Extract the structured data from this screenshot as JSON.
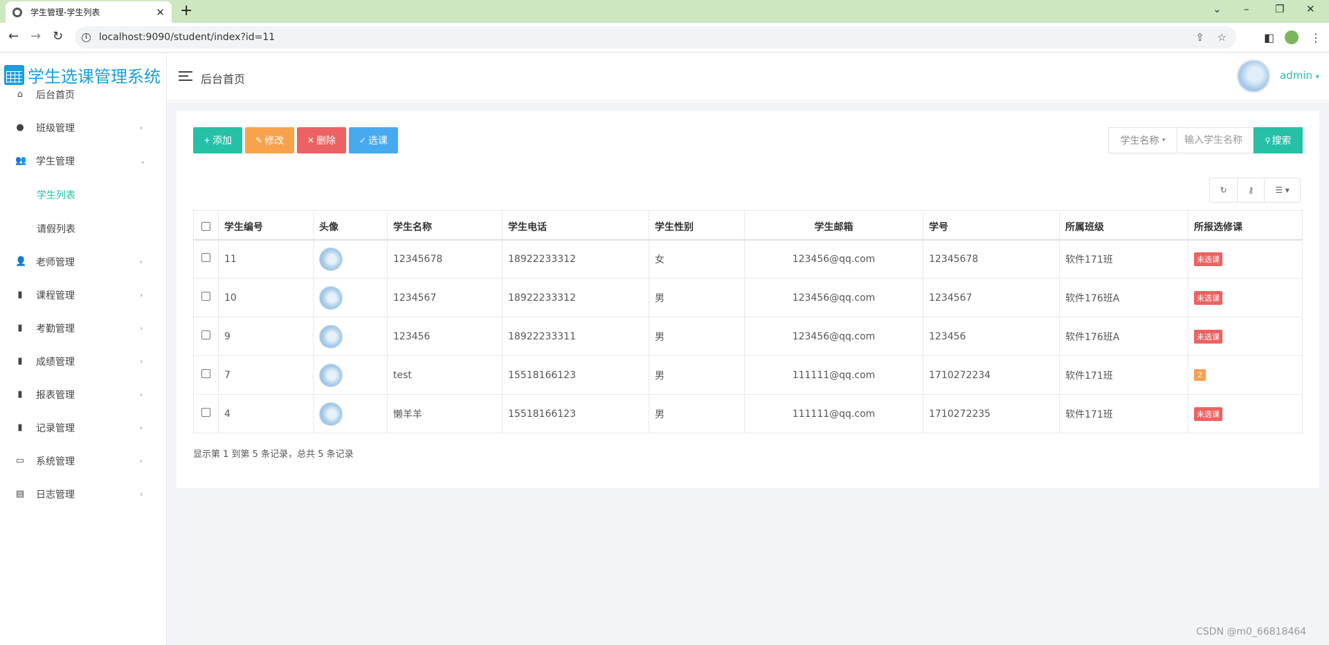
{
  "browser": {
    "tab_title": "学生管理-学生列表",
    "url": "localhost:9090/student/index?id=11"
  },
  "brand": {
    "title": "学生选课管理系统"
  },
  "sidebar": {
    "items": [
      {
        "label": "后台首页",
        "icon": "home-icon"
      },
      {
        "label": "班级管理",
        "icon": "palette-icon"
      },
      {
        "label": "学生管理",
        "icon": "users-icon"
      },
      {
        "label": "老师管理",
        "icon": "user-gear-icon"
      },
      {
        "label": "课程管理",
        "icon": "file-icon"
      },
      {
        "label": "考勤管理",
        "icon": "file-icon"
      },
      {
        "label": "成绩管理",
        "icon": "file-check-icon"
      },
      {
        "label": "报表管理",
        "icon": "file-chart-icon"
      },
      {
        "label": "记录管理",
        "icon": "file-icon"
      },
      {
        "label": "系统管理",
        "icon": "id-card-icon"
      },
      {
        "label": "日志管理",
        "icon": "list-icon"
      }
    ],
    "student_sub": [
      "学生列表",
      "请假列表"
    ]
  },
  "header": {
    "title": "后台首页",
    "user": "admin"
  },
  "toolbar": {
    "add": "添加",
    "edit": "修改",
    "delete": "删除",
    "select_course": "选课",
    "search_field": "学生名称",
    "search_placeholder": "输入学生名称",
    "search_button": "搜索"
  },
  "table": {
    "columns": [
      "学生编号",
      "头像",
      "学生名称",
      "学生电话",
      "学生性别",
      "学生邮箱",
      "学号",
      "所属班级",
      "所报选修课"
    ],
    "rows": [
      {
        "id": "11",
        "name": "12345678",
        "phone": "18922233312",
        "gender": "女",
        "email": "123456@qq.com",
        "sno": "12345678",
        "class": "软件171班",
        "course": "未选课"
      },
      {
        "id": "10",
        "name": "1234567",
        "phone": "18922233312",
        "gender": "男",
        "email": "123456@qq.com",
        "sno": "1234567",
        "class": "软件176班A",
        "course": "未选课"
      },
      {
        "id": "9",
        "name": "123456",
        "phone": "18922233311",
        "gender": "男",
        "email": "123456@qq.com",
        "sno": "123456",
        "class": "软件176班A",
        "course": "未选课"
      },
      {
        "id": "7",
        "name": "test",
        "phone": "15518166123",
        "gender": "男",
        "email": "111111@qq.com",
        "sno": "1710272234",
        "class": "软件171班",
        "course": "2"
      },
      {
        "id": "4",
        "name": "懒羊羊",
        "phone": "15518166123",
        "gender": "男",
        "email": "111111@qq.com",
        "sno": "1710272235",
        "class": "软件171班",
        "course": "未选课"
      }
    ]
  },
  "pagination": {
    "info": "显示第 1 到第 5 条记录，总共 5 条记录"
  },
  "watermark": "CSDN @m0_66818464",
  "colors": {
    "primary": "#26c0a6",
    "warning": "#f8a24d",
    "danger": "#ec6262",
    "info": "#47aaf0",
    "brand": "#1b9dde"
  }
}
